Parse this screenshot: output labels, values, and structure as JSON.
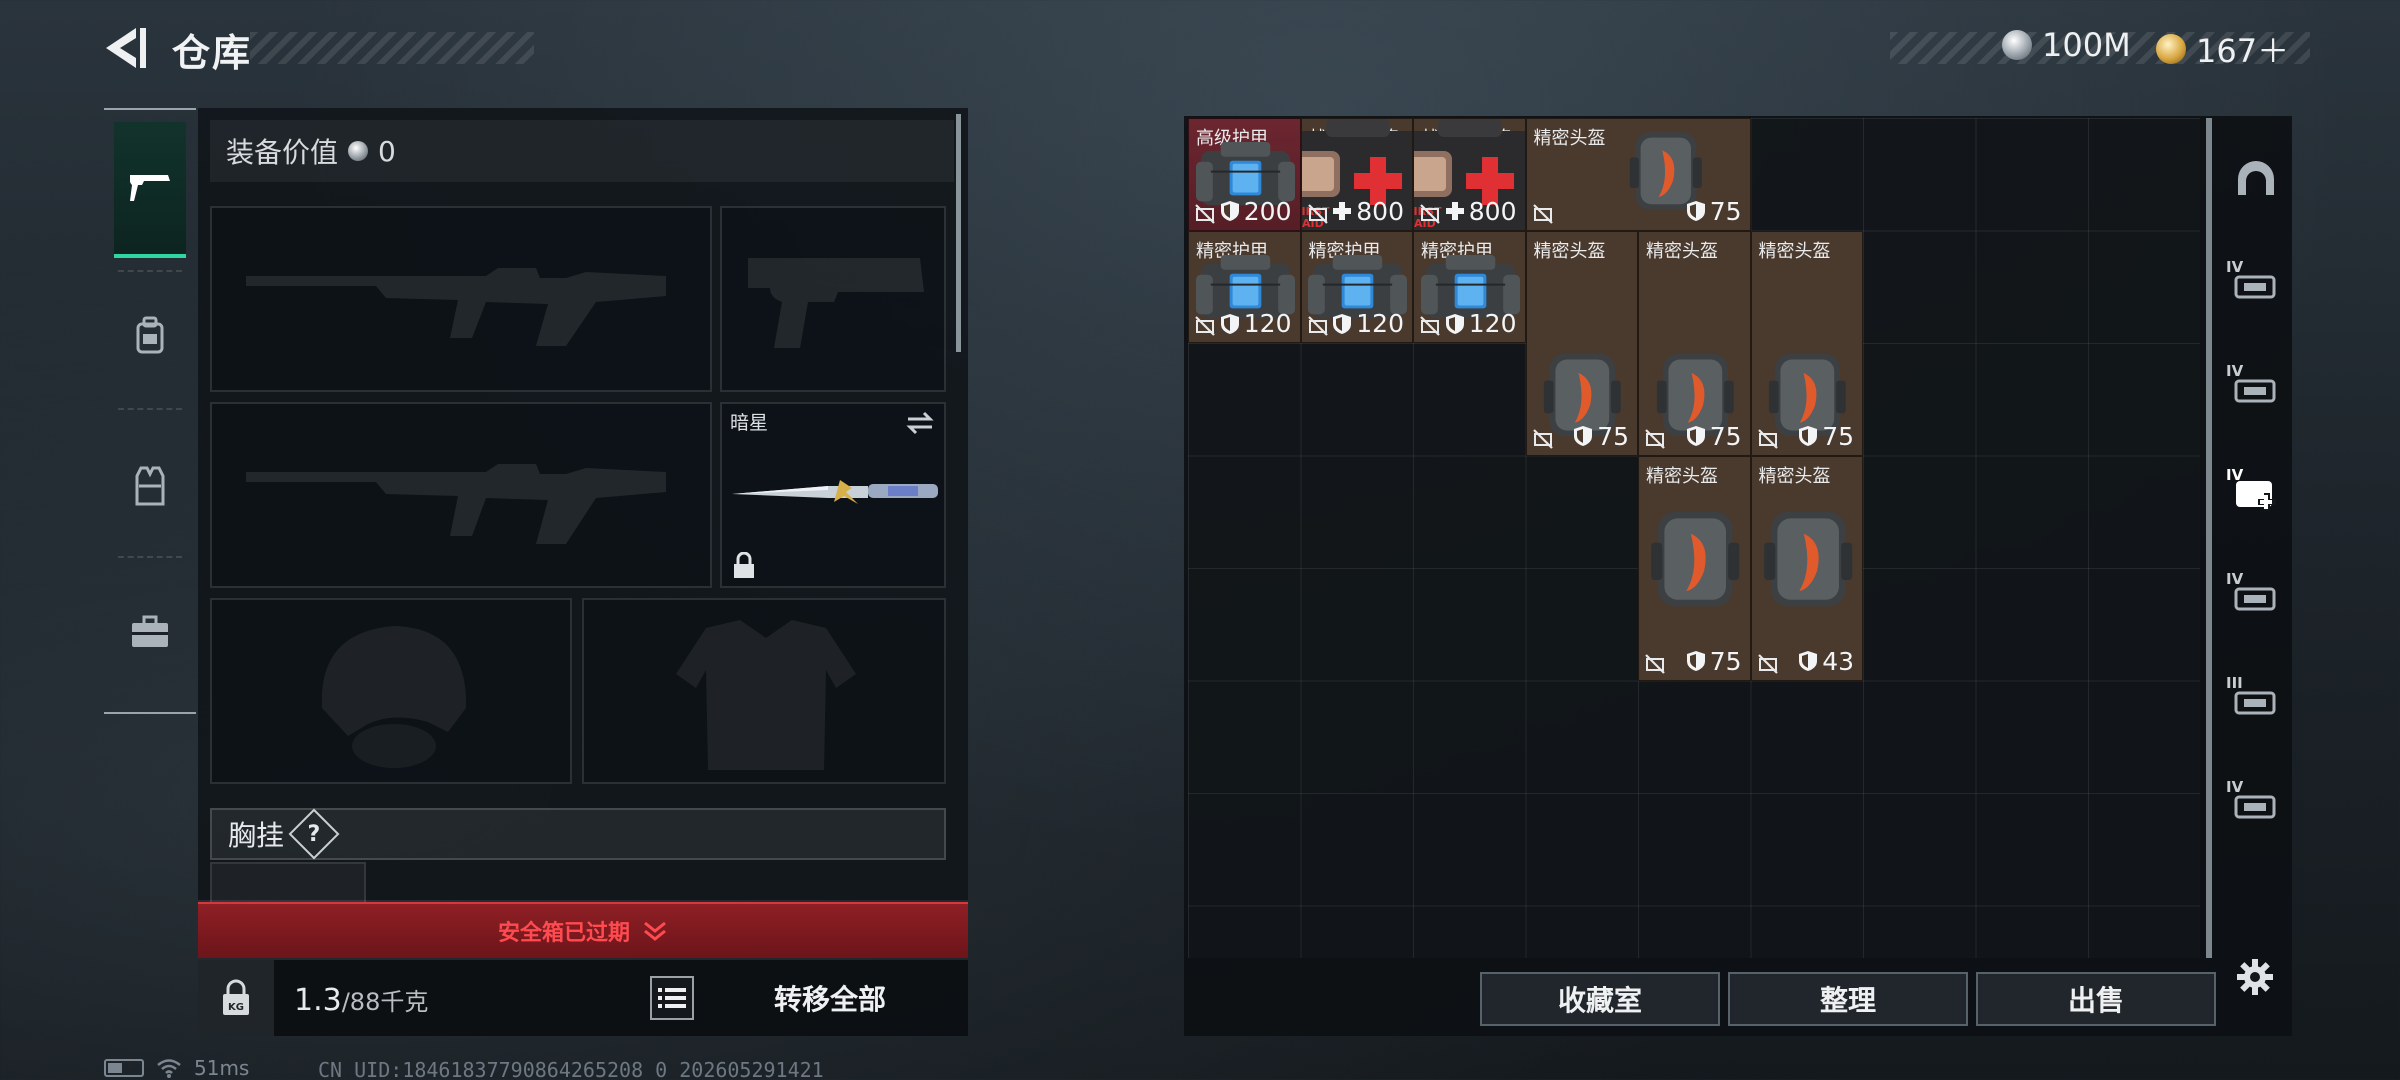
{
  "header": {
    "title": "仓库",
    "currencies": [
      {
        "icon": "silver-coin-icon",
        "value": "100M"
      },
      {
        "icon": "gold-coin-icon",
        "value": "167＋"
      }
    ]
  },
  "left_tabs": [
    {
      "icon": "pistol-icon",
      "active": true
    },
    {
      "icon": "backpack-icon",
      "active": false
    },
    {
      "icon": "vest-icon",
      "active": false
    },
    {
      "icon": "toolbox-icon",
      "active": false
    }
  ],
  "loadout": {
    "value_label": "装备价值",
    "value": "0",
    "melee_name": "暗星",
    "chest_label": "胸挂",
    "chest_help": "?",
    "safebox_status": "安全箱已过期",
    "weight_current": "1.3",
    "weight_max": "/88千克",
    "transfer_all": "转移全部"
  },
  "stash": {
    "items": [
      {
        "name": "高级护甲",
        "stat": "200",
        "stat_icon": "shield-icon",
        "kind": "armor",
        "highlight": true
      },
      {
        "name": "战地医疗箱",
        "stat": "800",
        "stat_icon": "plus-icon",
        "kind": "medkit"
      },
      {
        "name": "战地医疗箱",
        "stat": "800",
        "stat_icon": "plus-icon",
        "kind": "medkit"
      },
      {
        "name": "精密头盔",
        "stat": "75",
        "stat_icon": "shield-icon",
        "kind": "helmet-wide"
      },
      {
        "name": "精密头盔",
        "stat": "",
        "stat_icon": "",
        "kind": "helmet-top"
      },
      {
        "name": "精密头盔",
        "stat": "",
        "stat_icon": "",
        "kind": "helmet-top"
      },
      {
        "name": "精密头盔",
        "stat": "",
        "stat_icon": "",
        "kind": "helmet-top"
      },
      {
        "name": "精密护甲",
        "stat": "120",
        "stat_icon": "shield-icon",
        "kind": "armor"
      },
      {
        "name": "精密护甲",
        "stat": "120",
        "stat_icon": "shield-icon",
        "kind": "armor"
      },
      {
        "name": "精密护甲",
        "stat": "120",
        "stat_icon": "shield-icon",
        "kind": "armor"
      },
      {
        "name": "",
        "stat": "75",
        "stat_icon": "shield-icon",
        "kind": "helmet-bottom"
      },
      {
        "name": "",
        "stat": "75",
        "stat_icon": "shield-icon",
        "kind": "helmet-bottom"
      },
      {
        "name": "",
        "stat": "75",
        "stat_icon": "shield-icon",
        "kind": "helmet-bottom"
      },
      {
        "name": "精密头盔",
        "stat": "75",
        "stat_icon": "shield-icon",
        "kind": "helmet-tall"
      },
      {
        "name": "精密头盔",
        "stat": "43",
        "stat_icon": "shield-icon",
        "kind": "helmet-tall"
      }
    ],
    "categories": [
      {
        "icon": "helmet-category-icon",
        "tier": ""
      },
      {
        "icon": "rifle-category-icon",
        "tier": "IV"
      },
      {
        "icon": "ammo-category-icon",
        "tier": "IV"
      },
      {
        "icon": "medkit-category-icon",
        "tier": "IV",
        "active": true
      },
      {
        "icon": "grenade-category-icon",
        "tier": "IV"
      },
      {
        "icon": "key-category-icon",
        "tier": "III"
      },
      {
        "icon": "case-category-icon",
        "tier": "IV"
      }
    ],
    "actions": {
      "collection": "收藏室",
      "sort": "整理",
      "sell": "出售"
    }
  },
  "status": {
    "ping": "51ms",
    "uid": "CN UID:18461837790864265208 0_202605291421"
  },
  "colors": {
    "accent": "#2fd6a1",
    "warning": "#ff4b50",
    "item_bg": "#4a392d",
    "item_highlight": "#6c2630"
  }
}
